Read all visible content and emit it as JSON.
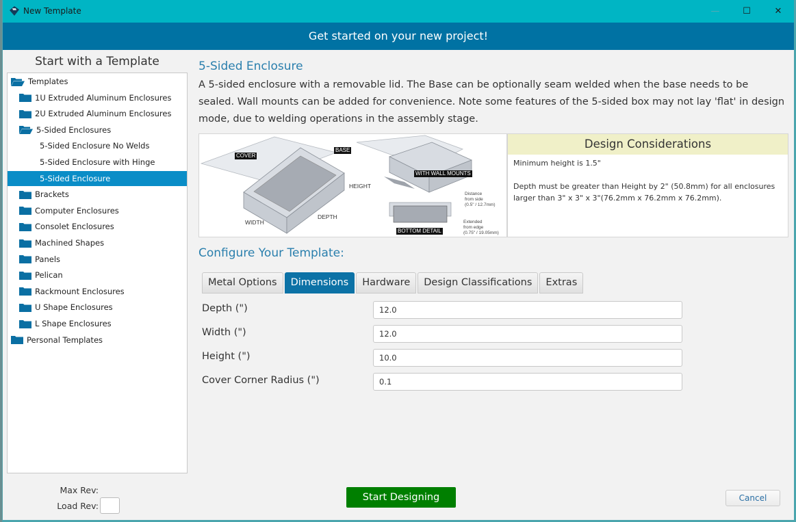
{
  "window": {
    "title": "New Template",
    "controls": {
      "minimize": "—",
      "maximize": "☐",
      "close": "✕"
    }
  },
  "banner": {
    "text": "Get started on your new project!"
  },
  "left": {
    "heading": "Start with a Template",
    "tree": [
      {
        "label": "Templates",
        "level": 0,
        "icon": "folder-open-icon"
      },
      {
        "label": "1U Extruded Aluminum Enclosures",
        "level": 1,
        "icon": "folder-icon"
      },
      {
        "label": "2U Extruded Aluminum Enclosures",
        "level": 1,
        "icon": "folder-icon"
      },
      {
        "label": "5-Sided Enclosures",
        "level": 1,
        "icon": "folder-open-icon"
      },
      {
        "label": "5-Sided Enclosure No Welds",
        "level": 2,
        "icon": ""
      },
      {
        "label": "5-Sided Enclosure with Hinge",
        "level": 2,
        "icon": ""
      },
      {
        "label": "5-Sided Enclosure",
        "level": 2,
        "icon": "",
        "selected": true
      },
      {
        "label": "Brackets",
        "level": 1,
        "icon": "folder-icon"
      },
      {
        "label": "Computer Enclosures",
        "level": 1,
        "icon": "folder-icon"
      },
      {
        "label": "Consolet Enclosures",
        "level": 1,
        "icon": "folder-icon"
      },
      {
        "label": "Machined Shapes",
        "level": 1,
        "icon": "folder-icon"
      },
      {
        "label": "Panels",
        "level": 1,
        "icon": "folder-icon"
      },
      {
        "label": "Pelican",
        "level": 1,
        "icon": "folder-icon"
      },
      {
        "label": "Rackmount Enclosures",
        "level": 1,
        "icon": "folder-icon"
      },
      {
        "label": "U Shape Enclosures",
        "level": 1,
        "icon": "folder-icon"
      },
      {
        "label": "L Shape Enclosures",
        "level": 1,
        "icon": "folder-icon"
      },
      {
        "label": "Personal Templates",
        "level": 0,
        "icon": "folder-icon"
      }
    ],
    "max_rev_label": "Max Rev:",
    "load_rev_label": "Load Rev:",
    "load_rev_value": ""
  },
  "main": {
    "template_title": "5-Sided Enclosure",
    "description": "A 5-sided enclosure with a removable lid. The Base can be optionally seam welded when the base needs to be sealed. Wall mounts can be added for convenience. Note some features of the 5-sided box may not lay 'flat' in design mode, due to welding operations in the assembly stage.",
    "image_labels": {
      "cover": "COVER",
      "base": "BASE",
      "height": "HEIGHT",
      "width": "WIDTH",
      "depth": "DEPTH",
      "wall_mounts": "WITH WALL MOUNTS",
      "bottom_detail": "BOTTOM DETAIL",
      "distance_1": "Distance",
      "distance_2": "from side",
      "distance_3": "(0.5\" / 12.7mm)",
      "extended_1": "Extended",
      "extended_2": "from edge",
      "extended_3": "(0.75\" / 19.05mm)"
    },
    "considerations": {
      "title": "Design Considerations",
      "line1": "Minimum height is 1.5\"",
      "line2": "Depth must be greater than Height by 2\" (50.8mm) for all enclosures larger than 3\" x 3\" x 3\"(76.2mm x 76.2mm x 76.2mm)."
    },
    "configure_heading": "Configure Your Template:",
    "tabs": [
      {
        "label": "Metal Options",
        "active": false
      },
      {
        "label": "Dimensions",
        "active": true
      },
      {
        "label": "Hardware",
        "active": false
      },
      {
        "label": "Design Classifications",
        "active": false
      },
      {
        "label": "Extras",
        "active": false
      }
    ],
    "fields": [
      {
        "label": "Depth (\")",
        "value": "12.0"
      },
      {
        "label": "Width (\")",
        "value": "12.0"
      },
      {
        "label": "Height (\")",
        "value": "10.0"
      },
      {
        "label": "Cover Corner Radius (\")",
        "value": "0.1"
      }
    ]
  },
  "footer": {
    "start_label": "Start Designing",
    "cancel_label": "Cancel"
  },
  "colors": {
    "titlebar": "#00b5c4",
    "banner": "#0072a3",
    "accent": "#2a7fad",
    "selected": "#0a8dc7",
    "start_button": "#007f00",
    "folder": "#0a6fa3"
  }
}
